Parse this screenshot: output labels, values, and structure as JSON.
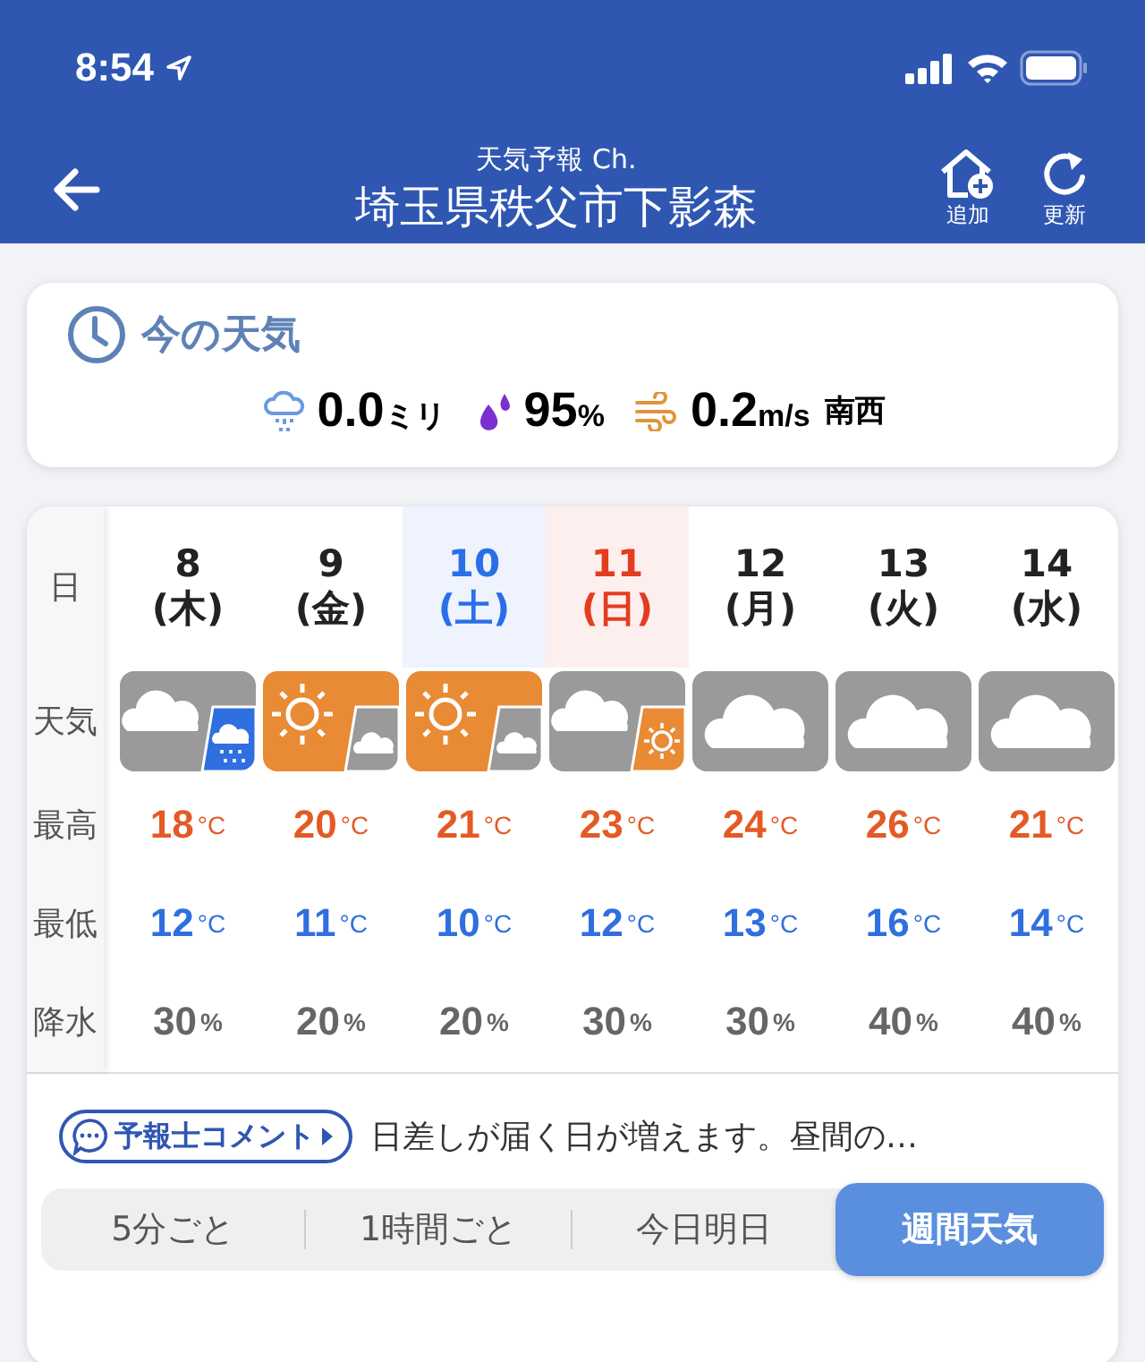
{
  "status_bar": {
    "time": "8:54"
  },
  "header": {
    "subtitle": "天気予報 Ch.",
    "title": "埼玉県秩父市下影森",
    "actions": [
      {
        "kind": "add",
        "label": "追加"
      },
      {
        "kind": "refresh",
        "label": "更新"
      }
    ]
  },
  "current": {
    "title": "今の天気",
    "precipitation": {
      "value": "0.0",
      "unit": "ミリ"
    },
    "humidity": {
      "value": "95",
      "unit": "%"
    },
    "wind": {
      "value": "0.2",
      "unit": "m/s",
      "direction": "南西"
    }
  },
  "forecast": {
    "row_labels": [
      "日",
      "天気",
      "最高",
      "最低",
      "降水"
    ],
    "days": [
      {
        "date": "8",
        "weekday": "(木)",
        "color": "#222222",
        "highlighted": false,
        "weather": {
          "kind": "cloudy_rain"
        },
        "high": "18",
        "high_unit": "°C",
        "low": "12",
        "low_unit": "°C",
        "precip": "30",
        "precip_unit": "%"
      },
      {
        "date": "9",
        "weekday": "(金)",
        "color": "#222222",
        "highlighted": false,
        "weather": {
          "kind": "sunny_cloudy"
        },
        "high": "20",
        "high_unit": "°C",
        "low": "11",
        "low_unit": "°C",
        "precip": "20",
        "precip_unit": "%"
      },
      {
        "date": "10",
        "weekday": "(土)",
        "color": "#2a6fe8",
        "highlighted": true,
        "weather": {
          "kind": "sunny_cloudy"
        },
        "high": "21",
        "high_unit": "°C",
        "low": "10",
        "low_unit": "°C",
        "precip": "20",
        "precip_unit": "%"
      },
      {
        "date": "11",
        "weekday": "(日)",
        "color": "#e23d20",
        "highlighted": true,
        "weather": {
          "kind": "cloudy_sunny"
        },
        "high": "23",
        "high_unit": "°C",
        "low": "12",
        "low_unit": "°C",
        "precip": "30",
        "precip_unit": "%"
      },
      {
        "date": "12",
        "weekday": "(月)",
        "color": "#222222",
        "highlighted": false,
        "weather": {
          "kind": "cloudy"
        },
        "high": "24",
        "high_unit": "°C",
        "low": "13",
        "low_unit": "°C",
        "precip": "30",
        "precip_unit": "%"
      },
      {
        "date": "13",
        "weekday": "(火)",
        "color": "#222222",
        "highlighted": false,
        "weather": {
          "kind": "cloudy"
        },
        "high": "26",
        "high_unit": "°C",
        "low": "16",
        "low_unit": "°C",
        "precip": "40",
        "precip_unit": "%"
      },
      {
        "date": "14",
        "weekday": "(水)",
        "color": "#222222",
        "highlighted": false,
        "weather": {
          "kind": "cloudy"
        },
        "high": "21",
        "high_unit": "°C",
        "low": "14",
        "low_unit": "°C",
        "precip": "40",
        "precip_unit": "%"
      }
    ]
  },
  "comment": {
    "badge": "予報士コメント",
    "text": "日差しが届く日が増えます。昼間の…"
  },
  "tabs": [
    {
      "label": "5分ごと",
      "selected": false
    },
    {
      "label": "1時間ごと",
      "selected": false
    },
    {
      "label": "今日明日",
      "selected": false
    },
    {
      "label": "週間天気",
      "selected": true
    }
  ]
}
